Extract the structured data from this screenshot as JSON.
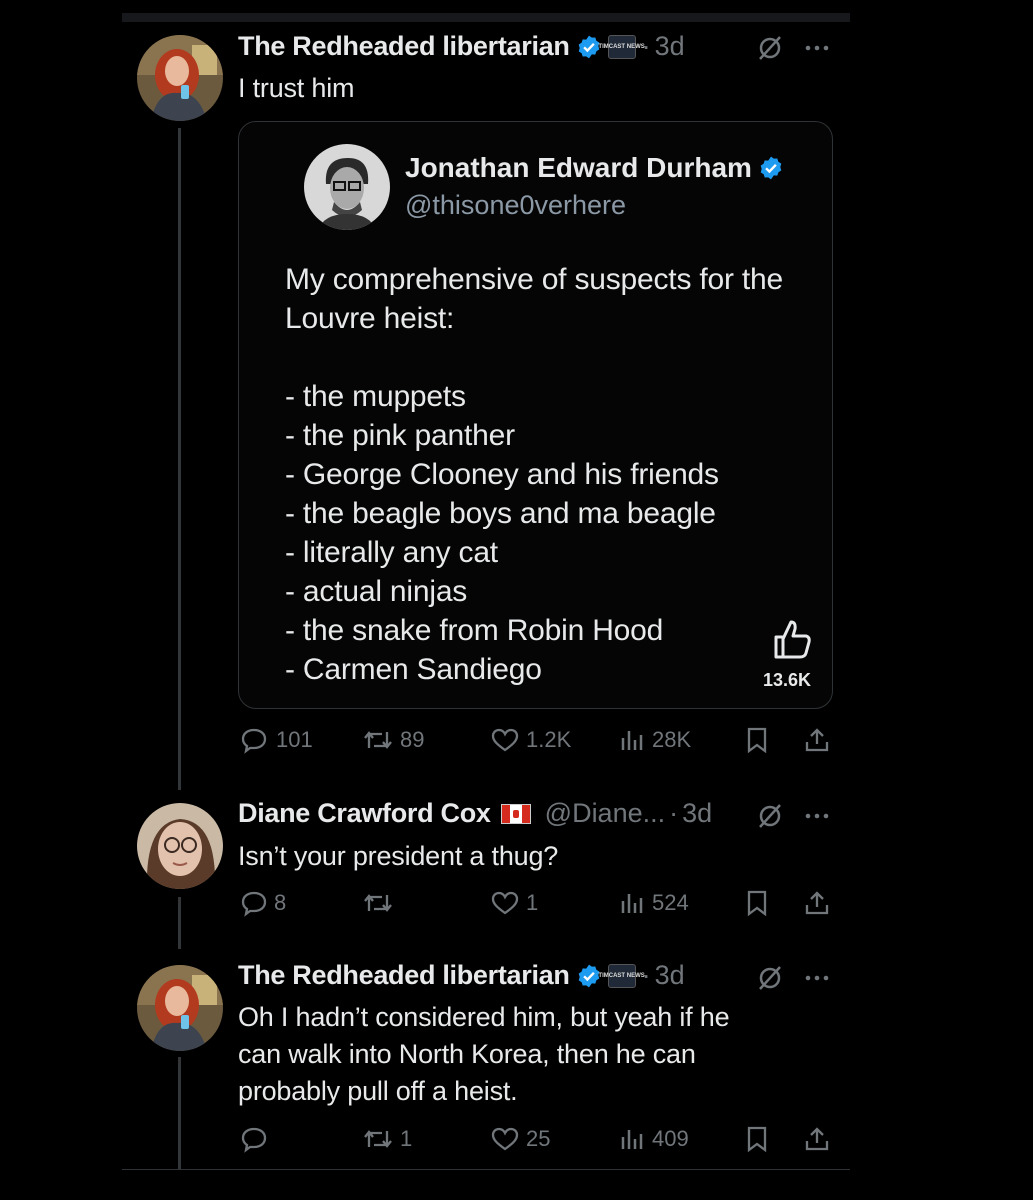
{
  "colors": {
    "background": "#000000",
    "text": "#e7e9ea",
    "muted": "#71767b",
    "verified": "#1d9bf0",
    "thread_line": "#333639"
  },
  "posts": [
    {
      "author": "The Redheaded libertarian",
      "affiliation_badge": "TIMCAST NEWS",
      "dot": "·",
      "time": "3d",
      "text": "I trust him",
      "quote": {
        "author": "Jonathan Edward Durham",
        "handle": "@thisone0verhere",
        "body": "My comprehensive of suspects for the Louvre heist:\n\n- the muppets\n- the pink panther\n- George Clooney and his friends\n- the beagle boys and ma beagle\n- literally any cat\n- actual ninjas\n- the snake from Robin Hood\n- Carmen Sandiego",
        "like_count": "13.6K"
      },
      "stats": {
        "replies": "101",
        "reposts": "89",
        "likes": "1.2K",
        "views": "28K"
      }
    },
    {
      "author": "Diane Crawford Cox",
      "handle": "@Diane...",
      "dot": "·",
      "time": "3d",
      "text": "Isn’t your president a thug?",
      "stats": {
        "replies": "8",
        "reposts": "",
        "likes": "1",
        "views": "524"
      }
    },
    {
      "author": "The Redheaded libertarian",
      "affiliation_badge": "TIMCAST NEWS",
      "dot": "·",
      "time": "3d",
      "text_lines": [
        "Oh I hadn’t considered him, but yeah if he",
        "can walk into North Korea, then he can",
        "probably pull off a heist."
      ],
      "stats": {
        "replies": "",
        "reposts": "1",
        "likes": "25",
        "views": "409"
      }
    }
  ],
  "icons": [
    "verified-badge-icon",
    "grok-slash-icon",
    "more-icon",
    "reply-icon",
    "repost-icon",
    "like-icon",
    "views-icon",
    "bookmark-icon",
    "share-icon",
    "thumbs-up-icon"
  ]
}
